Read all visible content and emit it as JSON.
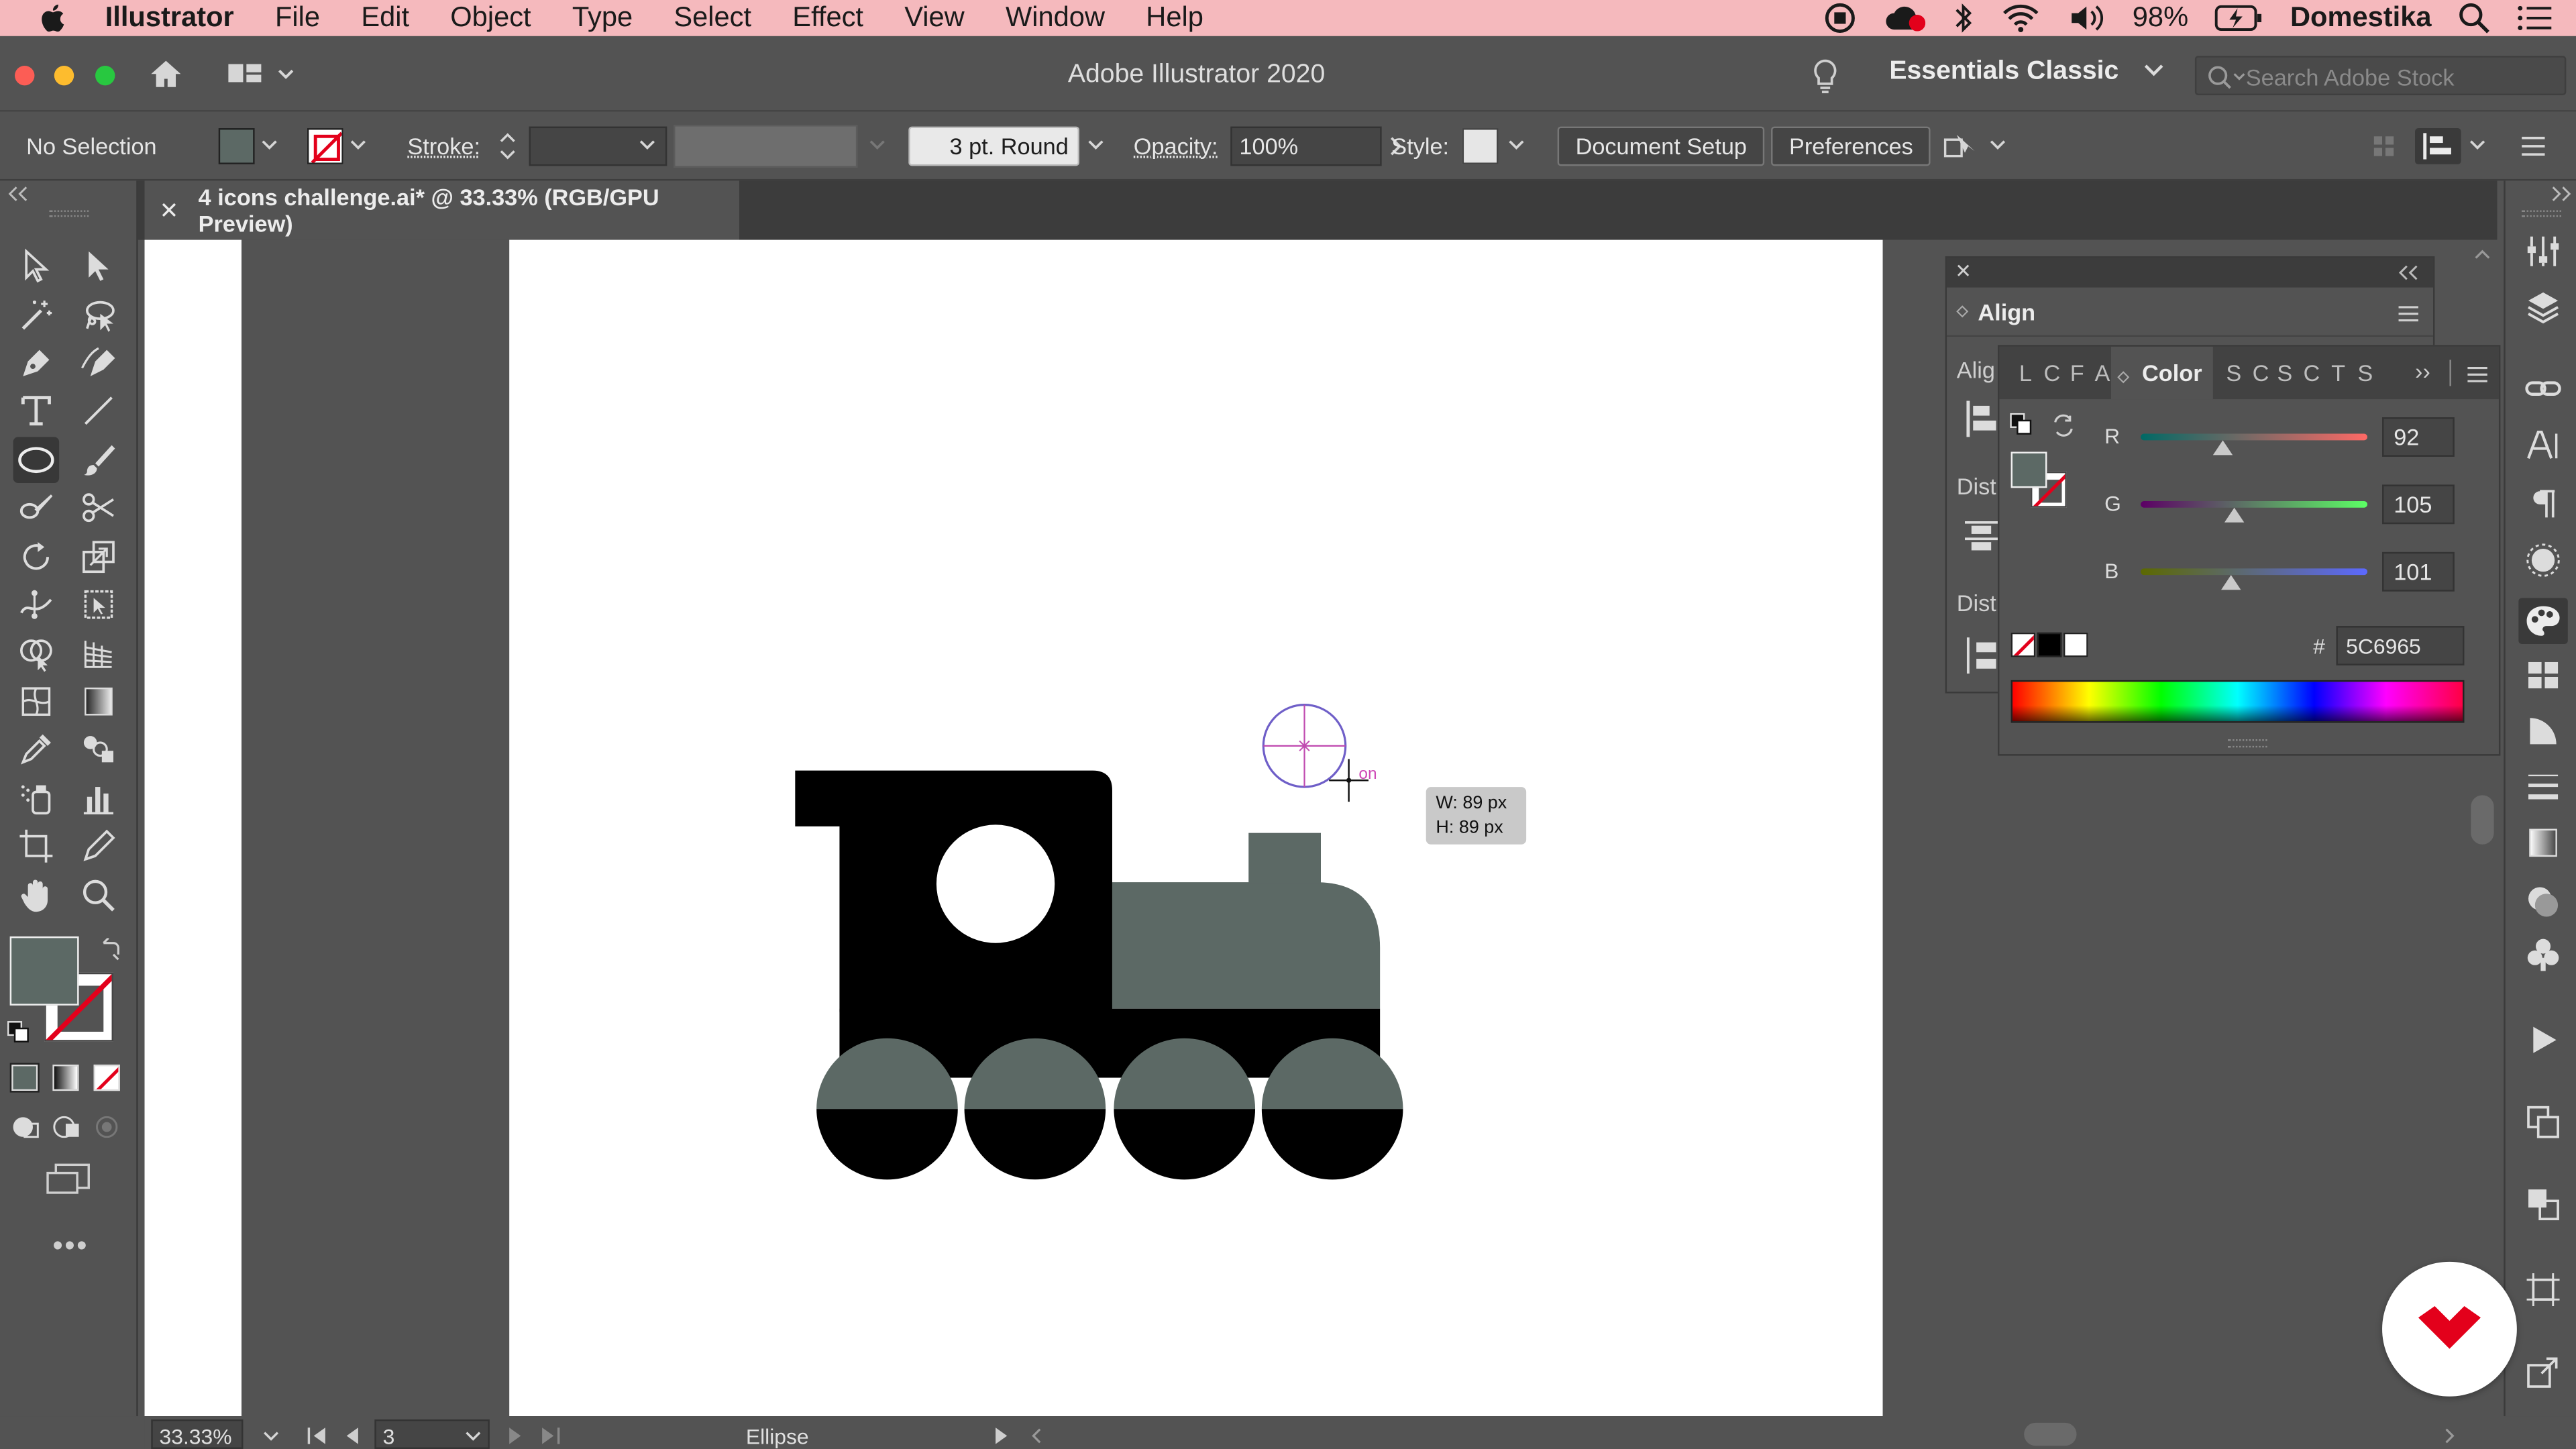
{
  "menubar": {
    "app": "Illustrator",
    "items": [
      "File",
      "Edit",
      "Object",
      "Type",
      "Select",
      "Effect",
      "View",
      "Window",
      "Help"
    ],
    "battery": "98%",
    "user": "Domestika"
  },
  "window": {
    "title": "Adobe Illustrator 2020",
    "workspace": "Essentials Classic",
    "stock_placeholder": "Search Adobe Stock"
  },
  "control": {
    "selection": "No Selection",
    "stroke_label": "Stroke:",
    "brush": "3 pt. Round",
    "opacity_label": "Opacity:",
    "opacity_value": "100%",
    "style_label": "Style:",
    "doc_setup": "Document Setup",
    "preferences": "Preferences"
  },
  "document": {
    "tab_title": "4 icons challenge.ai* @ 33.33% (RGB/GPU Preview)",
    "zoom": "33.33%",
    "artboard_num": "3",
    "status_tool": "Ellipse"
  },
  "tooltip": {
    "w": "W: 89 px",
    "h": "H: 89 px",
    "smart": "on"
  },
  "align_panel": {
    "title": "Align",
    "align_objects_short": "Alig",
    "distribute_short": "Dist",
    "distribute_short2": "Dist"
  },
  "color_panel": {
    "tabs_left": [
      "L",
      "C",
      "F",
      "A"
    ],
    "title": "Color",
    "tabs_right": [
      "S",
      "C",
      "S",
      "C",
      "T",
      "S"
    ],
    "r_label": "R",
    "g_label": "G",
    "b_label": "B",
    "r": 92,
    "g": 105,
    "b": 101,
    "hex_label": "#",
    "hex": "5C6965"
  },
  "colors": {
    "fill": "#5c6965",
    "ui_bg": "#535353",
    "menubar": "#f5b9bd",
    "brand": "#e3001b"
  }
}
